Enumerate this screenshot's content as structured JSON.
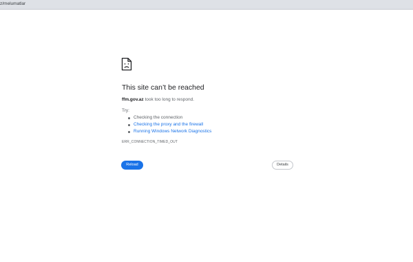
{
  "browser": {
    "address_text": "z/melumatlar"
  },
  "error": {
    "icon": "sad-page-icon",
    "title": "This site can’t be reached",
    "host": "ffm.gov.az",
    "message_suffix": " took too long to respond.",
    "try_label": "Try:",
    "suggestions": [
      {
        "label": "Checking the connection",
        "is_link": false
      },
      {
        "label": "Checking the proxy and the firewall",
        "is_link": true
      },
      {
        "label": "Running Windows Network Diagnostics",
        "is_link": true
      }
    ],
    "code": "ERR_CONNECTION_TIMED_OUT"
  },
  "buttons": {
    "reload_label": "Reload",
    "details_label": "Details"
  },
  "colors": {
    "accent": "#1a73e8",
    "text_primary": "#202124",
    "text_secondary": "#5f6368",
    "toolbar": "#dee1e6"
  }
}
